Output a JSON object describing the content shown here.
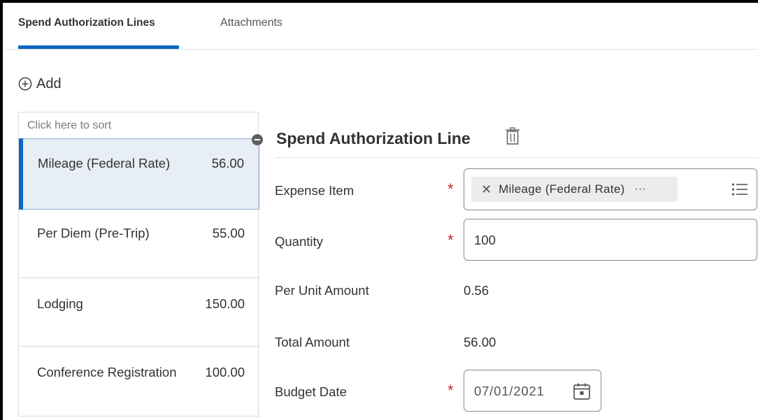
{
  "tabs": [
    {
      "label": "Spend Authorization Lines",
      "active": true
    },
    {
      "label": "Attachments",
      "active": false
    }
  ],
  "toolbar": {
    "add_label": "Add"
  },
  "list": {
    "sort_label": "Click here to sort",
    "items": [
      {
        "name": "Mileage (Federal Rate)",
        "amount": "56.00",
        "selected": true
      },
      {
        "name": "Per Diem (Pre-Trip)",
        "amount": "55.00"
      },
      {
        "name": "Lodging",
        "amount": "150.00"
      },
      {
        "name": "Conference Registration",
        "amount": "100.00"
      }
    ]
  },
  "detail": {
    "title": "Spend Authorization Line",
    "fields": {
      "expense_item": {
        "label": "Expense Item",
        "value": "Mileage (Federal Rate)",
        "more": "···"
      },
      "quantity": {
        "label": "Quantity",
        "value": "100"
      },
      "per_unit_amount": {
        "label": "Per Unit Amount",
        "value": "0.56"
      },
      "total_amount": {
        "label": "Total Amount",
        "value": "56.00"
      },
      "budget_date": {
        "label": "Budget Date",
        "value": "07/01/2021"
      }
    },
    "required_mark": "*"
  },
  "colors": {
    "accent": "#0b66c3",
    "required": "#d6212b",
    "selected_bg": "#e8eef6"
  },
  "icons": [
    "plus-circle-icon",
    "trash-icon",
    "remove-x-icon",
    "more-dots-icon",
    "list-icon",
    "calendar-icon",
    "collapse-icon"
  ]
}
